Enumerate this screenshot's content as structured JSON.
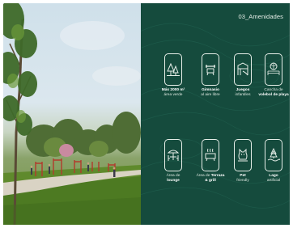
{
  "header": {
    "section_title": "03_Amenidades"
  },
  "colors": {
    "panel_bg": "#154b3d",
    "icon_stroke": "#e6eee8",
    "label_text": "#dfe9e2"
  },
  "amenities": [
    {
      "bold": "Más 2000 m²",
      "light": "área verde",
      "icon": "trees-icon"
    },
    {
      "bold": "Gimnasio",
      "light": "al aire libre",
      "icon": "dumbbell-icon"
    },
    {
      "bold": "Juegos",
      "light": "infantiles",
      "icon": "playground-icon"
    },
    {
      "bold": "volebol de playa",
      "light": "Cancha de",
      "icon": "volleyball-icon"
    },
    {
      "bold": "lounge",
      "light": "Área de",
      "icon": "umbrella-table-icon"
    },
    {
      "bold": "Terraza",
      "light": "Área de",
      "bold2": "& grill",
      "icon": "grill-icon"
    },
    {
      "bold": "Pet",
      "light": "friendly",
      "icon": "pet-icon"
    },
    {
      "bold": "Lago",
      "light": "artificial",
      "icon": "lake-icon"
    }
  ]
}
